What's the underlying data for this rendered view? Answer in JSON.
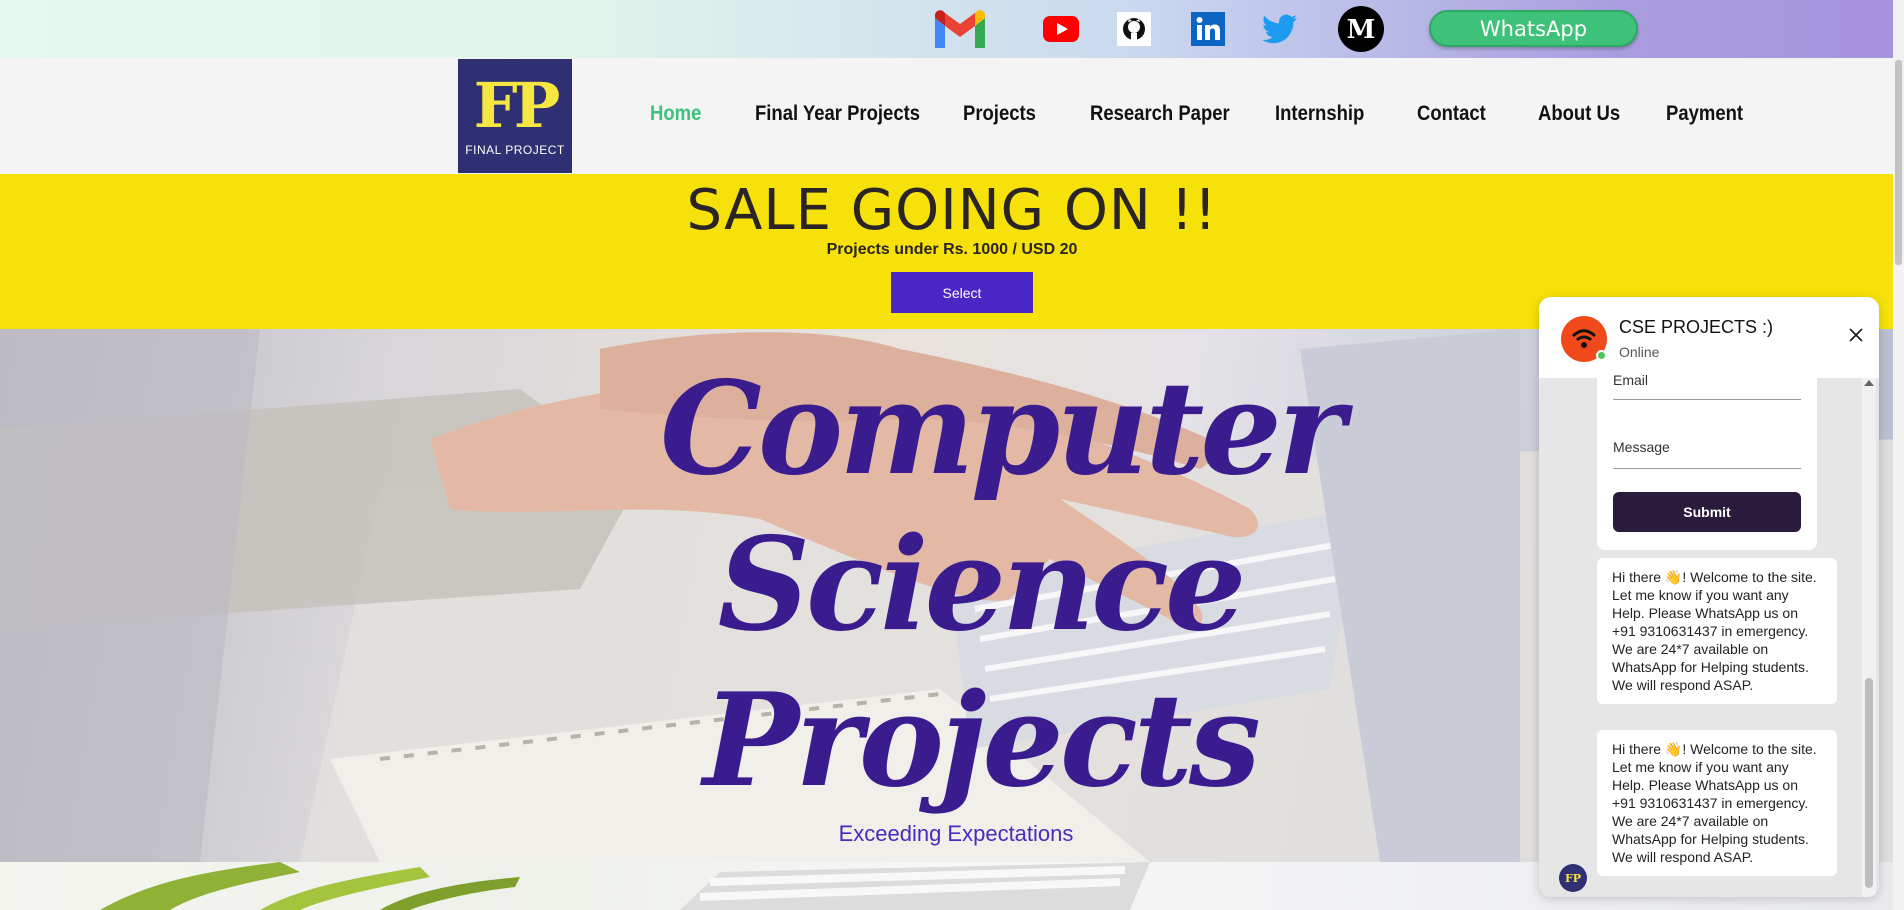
{
  "social": {
    "icons": [
      "gmail-icon",
      "youtube-icon",
      "github-icon",
      "linkedin-icon",
      "twitter-icon",
      "medium-icon"
    ],
    "whatsapp_label": "WhatsApp"
  },
  "logo": {
    "mark": "FP",
    "sub": "FINAL PROJECT"
  },
  "nav": {
    "items": [
      "Home",
      "Final Year Projects",
      "Projects",
      "Research Paper",
      "Internship",
      "Contact",
      "About Us",
      "Payment"
    ],
    "active": "Home"
  },
  "sale": {
    "title": "SALE GOING ON !!",
    "subtitle": "Projects under Rs. 1000 / USD 20",
    "button": "Select"
  },
  "hero": {
    "line1": "Computer",
    "line2": "Science",
    "line3": "Projects",
    "tagline": "Exceeding Expectations"
  },
  "chat": {
    "title": "CSE PROJECTS :)",
    "status": "Online",
    "form": {
      "email_label": "Email",
      "message_label": "Message",
      "submit": "Submit"
    },
    "messages": [
      "Hi there 👋! Welcome to the site. Let me know if you want any Help. Please WhatsApp us on +91 9310631437 in emergency. We are 24*7 available on WhatsApp for Helping students. We will respond ASAP.",
      "Hi there 👋! Welcome to the site. Let me know if you want any Help. Please WhatsApp us on +91 9310631437 in emergency. We are 24*7 available on WhatsApp for Helping students. We will respond ASAP."
    ]
  },
  "colors": {
    "accent_green": "#3ec27a",
    "banner_yellow": "#f6e20a",
    "button_purple": "#4a26c4",
    "hero_text": "#3a1c8f",
    "logo_bg": "#2f2f73"
  }
}
